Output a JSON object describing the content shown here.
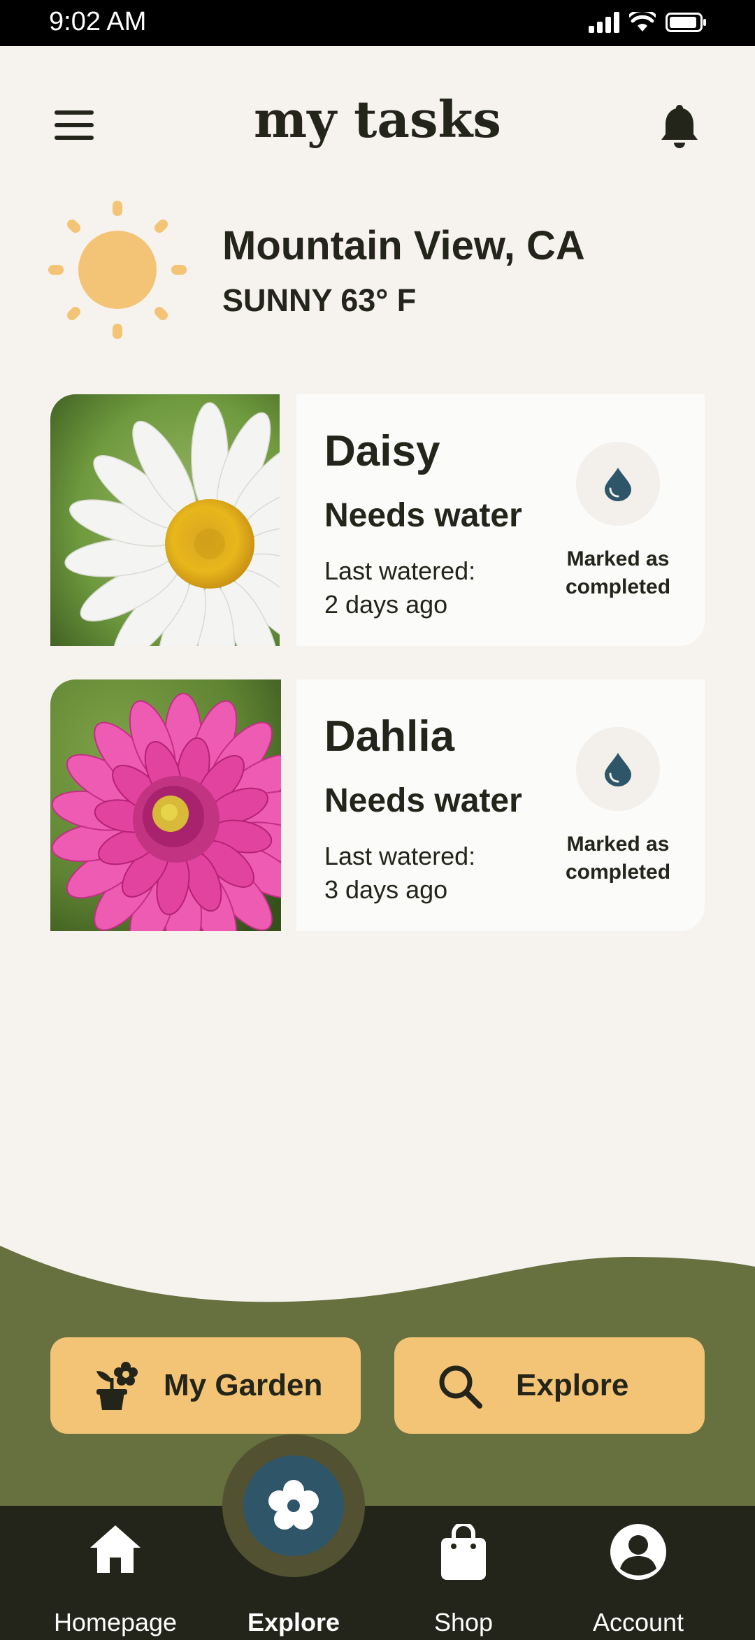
{
  "status_bar": {
    "time": "9:02 AM"
  },
  "header": {
    "title": "my tasks",
    "menu_icon": "hamburger-icon",
    "notification_icon": "bell-icon"
  },
  "weather": {
    "location": "Mountain View, CA",
    "condition": "SUNNY 63° F",
    "icon": "sun-icon"
  },
  "tasks": [
    {
      "name": "Daisy",
      "status": "Needs water",
      "last_label": "Last watered:",
      "last_value": "2 days ago",
      "action_icon": "water-drop-icon",
      "action_state": "Marked as completed"
    },
    {
      "name": "Dahlia",
      "status": "Needs water",
      "last_label": "Last watered:",
      "last_value": "3 days ago",
      "action_icon": "water-drop-icon",
      "action_state": "Marked as completed"
    }
  ],
  "quick_actions": [
    {
      "label": "My Garden",
      "icon": "plant-pot-icon"
    },
    {
      "label": "Explore",
      "icon": "search-icon"
    }
  ],
  "bottom_nav": {
    "items": [
      {
        "label": "Homepage",
        "icon": "home-icon"
      },
      {
        "label": "Explore",
        "icon": "flower-icon",
        "active": true
      },
      {
        "label": "Shop",
        "icon": "shopping-bag-icon"
      },
      {
        "label": "Account",
        "icon": "account-icon"
      }
    ]
  },
  "colors": {
    "background": "#f6f3ef",
    "text": "#23241a",
    "accent_yellow": "#f3c475",
    "green": "#67703f",
    "nav_dark": "#24251a",
    "teal": "#2e5568"
  }
}
